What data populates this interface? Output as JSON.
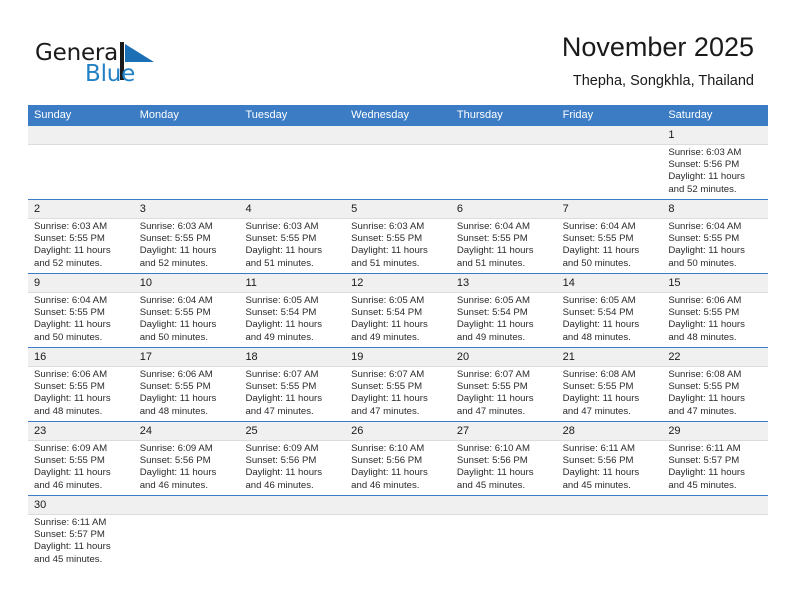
{
  "brand": {
    "name_part1": "General",
    "name_part2": "Blue",
    "flag_icon": "blue-flag-triangle"
  },
  "header": {
    "month_title": "November 2025",
    "location": "Thepha, Songkhla, Thailand"
  },
  "colors": {
    "header_blue": "#3b7cc4",
    "brand_blue": "#2280c4",
    "daynum_band": "#f0f0f0",
    "text": "#1a1a1a"
  },
  "weekdays": [
    "Sunday",
    "Monday",
    "Tuesday",
    "Wednesday",
    "Thursday",
    "Friday",
    "Saturday"
  ],
  "weeks": [
    [
      {
        "day": "",
        "lines": []
      },
      {
        "day": "",
        "lines": []
      },
      {
        "day": "",
        "lines": []
      },
      {
        "day": "",
        "lines": []
      },
      {
        "day": "",
        "lines": []
      },
      {
        "day": "",
        "lines": []
      },
      {
        "day": "1",
        "lines": [
          "Sunrise: 6:03 AM",
          "Sunset: 5:56 PM",
          "Daylight: 11 hours",
          "and 52 minutes."
        ]
      }
    ],
    [
      {
        "day": "2",
        "lines": [
          "Sunrise: 6:03 AM",
          "Sunset: 5:55 PM",
          "Daylight: 11 hours",
          "and 52 minutes."
        ]
      },
      {
        "day": "3",
        "lines": [
          "Sunrise: 6:03 AM",
          "Sunset: 5:55 PM",
          "Daylight: 11 hours",
          "and 52 minutes."
        ]
      },
      {
        "day": "4",
        "lines": [
          "Sunrise: 6:03 AM",
          "Sunset: 5:55 PM",
          "Daylight: 11 hours",
          "and 51 minutes."
        ]
      },
      {
        "day": "5",
        "lines": [
          "Sunrise: 6:03 AM",
          "Sunset: 5:55 PM",
          "Daylight: 11 hours",
          "and 51 minutes."
        ]
      },
      {
        "day": "6",
        "lines": [
          "Sunrise: 6:04 AM",
          "Sunset: 5:55 PM",
          "Daylight: 11 hours",
          "and 51 minutes."
        ]
      },
      {
        "day": "7",
        "lines": [
          "Sunrise: 6:04 AM",
          "Sunset: 5:55 PM",
          "Daylight: 11 hours",
          "and 50 minutes."
        ]
      },
      {
        "day": "8",
        "lines": [
          "Sunrise: 6:04 AM",
          "Sunset: 5:55 PM",
          "Daylight: 11 hours",
          "and 50 minutes."
        ]
      }
    ],
    [
      {
        "day": "9",
        "lines": [
          "Sunrise: 6:04 AM",
          "Sunset: 5:55 PM",
          "Daylight: 11 hours",
          "and 50 minutes."
        ]
      },
      {
        "day": "10",
        "lines": [
          "Sunrise: 6:04 AM",
          "Sunset: 5:55 PM",
          "Daylight: 11 hours",
          "and 50 minutes."
        ]
      },
      {
        "day": "11",
        "lines": [
          "Sunrise: 6:05 AM",
          "Sunset: 5:54 PM",
          "Daylight: 11 hours",
          "and 49 minutes."
        ]
      },
      {
        "day": "12",
        "lines": [
          "Sunrise: 6:05 AM",
          "Sunset: 5:54 PM",
          "Daylight: 11 hours",
          "and 49 minutes."
        ]
      },
      {
        "day": "13",
        "lines": [
          "Sunrise: 6:05 AM",
          "Sunset: 5:54 PM",
          "Daylight: 11 hours",
          "and 49 minutes."
        ]
      },
      {
        "day": "14",
        "lines": [
          "Sunrise: 6:05 AM",
          "Sunset: 5:54 PM",
          "Daylight: 11 hours",
          "and 48 minutes."
        ]
      },
      {
        "day": "15",
        "lines": [
          "Sunrise: 6:06 AM",
          "Sunset: 5:55 PM",
          "Daylight: 11 hours",
          "and 48 minutes."
        ]
      }
    ],
    [
      {
        "day": "16",
        "lines": [
          "Sunrise: 6:06 AM",
          "Sunset: 5:55 PM",
          "Daylight: 11 hours",
          "and 48 minutes."
        ]
      },
      {
        "day": "17",
        "lines": [
          "Sunrise: 6:06 AM",
          "Sunset: 5:55 PM",
          "Daylight: 11 hours",
          "and 48 minutes."
        ]
      },
      {
        "day": "18",
        "lines": [
          "Sunrise: 6:07 AM",
          "Sunset: 5:55 PM",
          "Daylight: 11 hours",
          "and 47 minutes."
        ]
      },
      {
        "day": "19",
        "lines": [
          "Sunrise: 6:07 AM",
          "Sunset: 5:55 PM",
          "Daylight: 11 hours",
          "and 47 minutes."
        ]
      },
      {
        "day": "20",
        "lines": [
          "Sunrise: 6:07 AM",
          "Sunset: 5:55 PM",
          "Daylight: 11 hours",
          "and 47 minutes."
        ]
      },
      {
        "day": "21",
        "lines": [
          "Sunrise: 6:08 AM",
          "Sunset: 5:55 PM",
          "Daylight: 11 hours",
          "and 47 minutes."
        ]
      },
      {
        "day": "22",
        "lines": [
          "Sunrise: 6:08 AM",
          "Sunset: 5:55 PM",
          "Daylight: 11 hours",
          "and 47 minutes."
        ]
      }
    ],
    [
      {
        "day": "23",
        "lines": [
          "Sunrise: 6:09 AM",
          "Sunset: 5:55 PM",
          "Daylight: 11 hours",
          "and 46 minutes."
        ]
      },
      {
        "day": "24",
        "lines": [
          "Sunrise: 6:09 AM",
          "Sunset: 5:56 PM",
          "Daylight: 11 hours",
          "and 46 minutes."
        ]
      },
      {
        "day": "25",
        "lines": [
          "Sunrise: 6:09 AM",
          "Sunset: 5:56 PM",
          "Daylight: 11 hours",
          "and 46 minutes."
        ]
      },
      {
        "day": "26",
        "lines": [
          "Sunrise: 6:10 AM",
          "Sunset: 5:56 PM",
          "Daylight: 11 hours",
          "and 46 minutes."
        ]
      },
      {
        "day": "27",
        "lines": [
          "Sunrise: 6:10 AM",
          "Sunset: 5:56 PM",
          "Daylight: 11 hours",
          "and 45 minutes."
        ]
      },
      {
        "day": "28",
        "lines": [
          "Sunrise: 6:11 AM",
          "Sunset: 5:56 PM",
          "Daylight: 11 hours",
          "and 45 minutes."
        ]
      },
      {
        "day": "29",
        "lines": [
          "Sunrise: 6:11 AM",
          "Sunset: 5:57 PM",
          "Daylight: 11 hours",
          "and 45 minutes."
        ]
      }
    ],
    [
      {
        "day": "30",
        "lines": [
          "Sunrise: 6:11 AM",
          "Sunset: 5:57 PM",
          "Daylight: 11 hours",
          "and 45 minutes."
        ]
      },
      {
        "day": "",
        "lines": []
      },
      {
        "day": "",
        "lines": []
      },
      {
        "day": "",
        "lines": []
      },
      {
        "day": "",
        "lines": []
      },
      {
        "day": "",
        "lines": []
      },
      {
        "day": "",
        "lines": []
      }
    ]
  ]
}
